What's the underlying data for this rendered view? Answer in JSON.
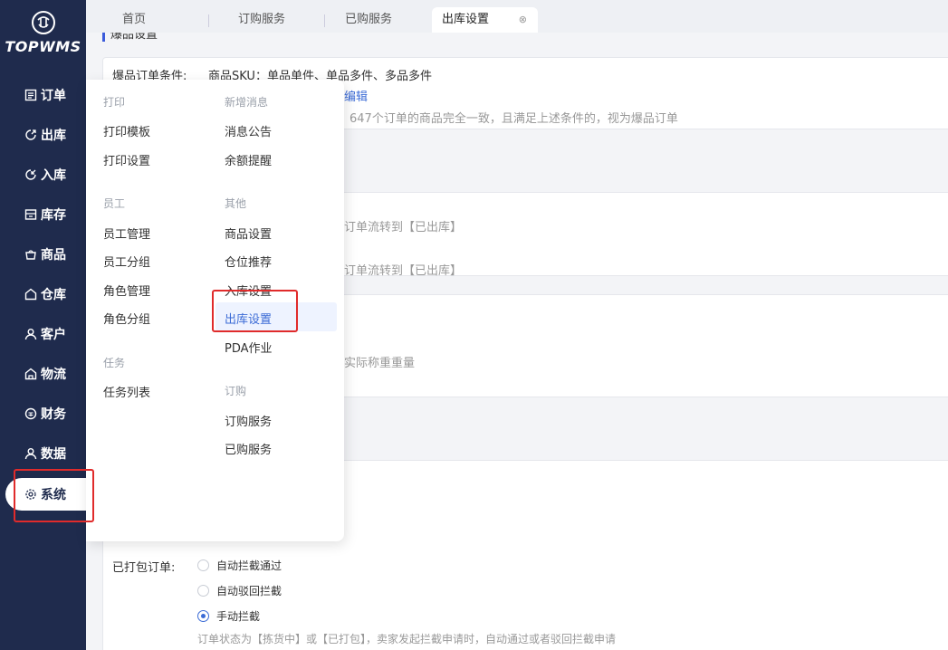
{
  "app": {
    "logo_text": "TOPWMS"
  },
  "sidebar": {
    "items": [
      {
        "label": "订单",
        "icon": "order-icon"
      },
      {
        "label": "出库",
        "icon": "outbound-icon"
      },
      {
        "label": "入库",
        "icon": "inbound-icon"
      },
      {
        "label": "库存",
        "icon": "inventory-icon"
      },
      {
        "label": "商品",
        "icon": "goods-icon"
      },
      {
        "label": "仓库",
        "icon": "warehouse-icon"
      },
      {
        "label": "客户",
        "icon": "customer-icon"
      },
      {
        "label": "物流",
        "icon": "logistics-icon"
      },
      {
        "label": "财务",
        "icon": "finance-icon"
      },
      {
        "label": "数据",
        "icon": "data-icon"
      },
      {
        "label": "系统",
        "icon": "gear-icon",
        "active": true
      }
    ]
  },
  "tabs": [
    {
      "label": "首页"
    },
    {
      "label": "订购服务"
    },
    {
      "label": "已购服务"
    },
    {
      "label": "出库设置",
      "active": true,
      "close": "⊗"
    }
  ],
  "content": {
    "section_title": "爆品设置",
    "hot_condition_label": "爆品订单条件:",
    "hot_condition_value": "商品SKU：单品单件、单品多件、多品多件",
    "edit_link": "编辑",
    "hot_desc_fragment": "647个订单的商品完全一致，且满足上述条件的，视为爆品订单",
    "flow_text_1": "订单流转到【已出库】",
    "flow_text_2": "订单流转到【已出库】",
    "weigh_text": "实际称重重量",
    "packed_label": "已打包订单:",
    "radio_options": [
      {
        "label": "自动拦截通过",
        "checked": false
      },
      {
        "label": "自动驳回拦截",
        "checked": false
      },
      {
        "label": "手动拦截",
        "checked": true
      }
    ],
    "packed_desc": "订单状态为【拣货中】或【已打包】，卖家发起拦截申请时，自动通过或者驳回拦截申请"
  },
  "menu": {
    "groups_left": [
      {
        "title": "打印",
        "items": [
          "打印模板",
          "打印设置"
        ]
      },
      {
        "title": "员工",
        "items": [
          "员工管理",
          "员工分组",
          "角色管理",
          "角色分组"
        ]
      },
      {
        "title": "任务",
        "items": [
          "任务列表"
        ]
      }
    ],
    "groups_right": [
      {
        "title": "新增消息",
        "items": [
          "消息公告",
          "余额提醒"
        ]
      },
      {
        "title": "其他",
        "items": [
          "商品设置",
          "仓位推荐",
          "入库设置",
          "出库设置",
          "PDA作业"
        ]
      },
      {
        "title": "订购",
        "items": [
          "订购服务",
          "已购服务"
        ]
      }
    ],
    "active_item": "出库设置"
  },
  "colors": {
    "sidebar_bg": "#1f2b4d",
    "accent": "#3b6bd6",
    "highlight": "#e02b2b"
  }
}
